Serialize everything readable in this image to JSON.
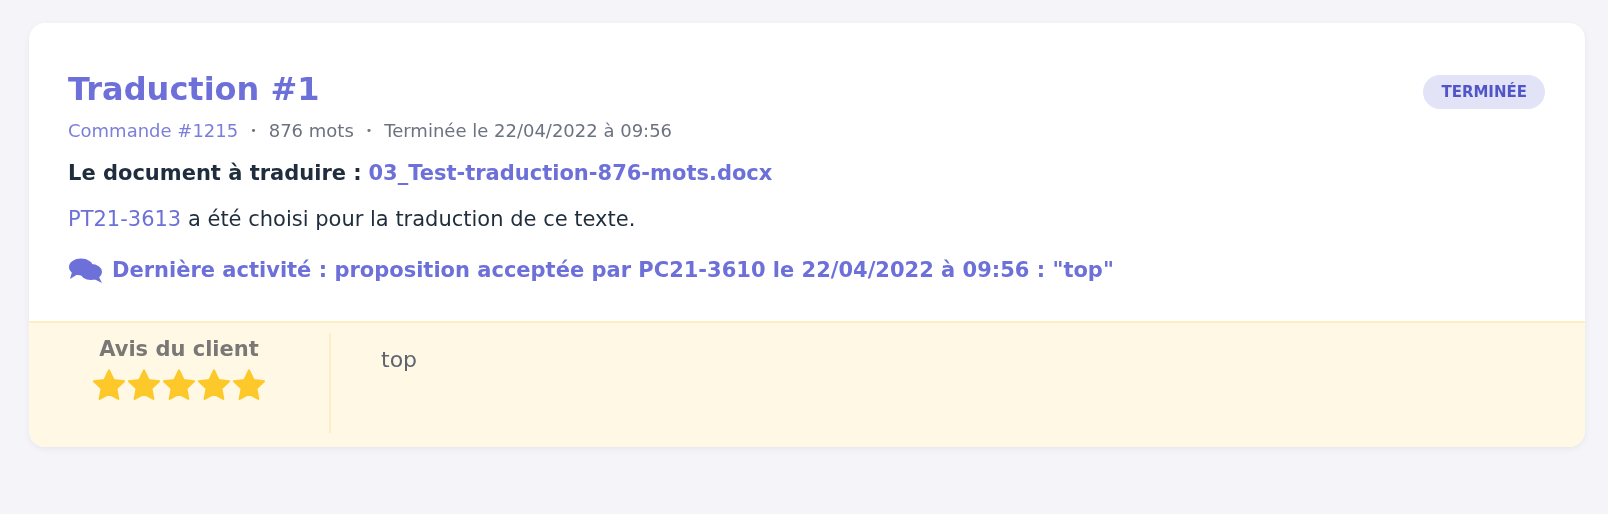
{
  "card": {
    "title": "Traduction #1",
    "status": "TERMINÉE",
    "meta": [
      {
        "kind": "link",
        "text": "Commande #1215"
      },
      {
        "kind": "text",
        "text": "876 mots"
      },
      {
        "kind": "text",
        "text": "Terminée le 22/04/2022 à 09:56"
      }
    ],
    "meta_separator": "•",
    "document": {
      "label": "Le document à traduire :",
      "file": "03_Test-traduction-876-mots.docx"
    },
    "translator": {
      "link": "PT21-3613",
      "text": "a été choisi pour la traduction de ce texte."
    },
    "activity": "Dernière activité : proposition acceptée par PC21-3610 le 22/04/2022 à 09:56 : \"top\"",
    "review": {
      "title": "Avis du client",
      "stars": 5,
      "comment": "top"
    }
  }
}
